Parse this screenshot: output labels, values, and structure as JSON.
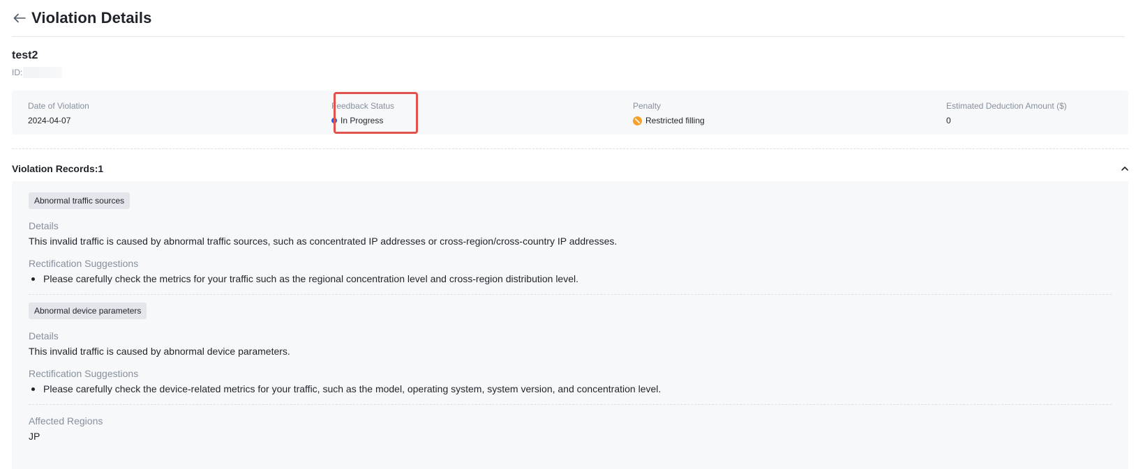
{
  "header": {
    "title": "Violation Details"
  },
  "record": {
    "name": "test2",
    "id_label": "ID:"
  },
  "summary": {
    "date": {
      "label": "Date of Violation",
      "value": "2024-04-07"
    },
    "feedback": {
      "label": "Feedback Status",
      "value": "In Progress",
      "status_color": "#1664ff"
    },
    "penalty": {
      "label": "Penalty",
      "value": "Restricted filling",
      "icon": "restricted-icon",
      "icon_color": "#f7a12a"
    },
    "deduction": {
      "label": "Estimated Deduction Amount ($)",
      "value": "0"
    }
  },
  "records": {
    "title": "Violation Records:1",
    "items": [
      {
        "tag": "Abnormal traffic sources",
        "details_label": "Details",
        "details": "This invalid traffic is caused by abnormal traffic sources, such as concentrated IP addresses or cross-region/cross-country IP addresses.",
        "suggestions_label": "Rectification Suggestions",
        "suggestion": "Please carefully check the metrics for your traffic such as the regional concentration level and cross-region distribution level."
      },
      {
        "tag": "Abnormal device parameters",
        "details_label": "Details",
        "details": "This invalid traffic is caused by abnormal device parameters.",
        "suggestions_label": "Rectification Suggestions",
        "suggestion": "Please carefully check the device-related metrics for your traffic, such as the model, operating system, system version, and concentration level."
      }
    ],
    "affected_label": "Affected Regions",
    "affected_value": "JP"
  }
}
